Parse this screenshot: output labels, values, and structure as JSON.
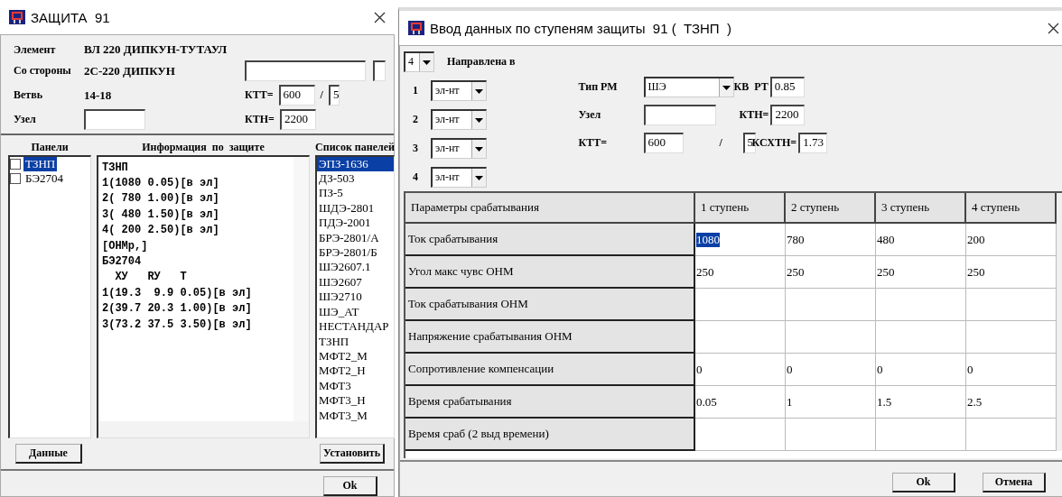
{
  "left_window": {
    "title": "ЗАЩИТА  91",
    "fields": {
      "element_label": "Элемент",
      "element_value": "ВЛ 220 ДИПКУН-ТУТАУЛ",
      "side_label": "Со стороны",
      "side_value": "2С-220 ДИПКУН",
      "branch_label": "Ветвь",
      "branch_value": "14-18",
      "node_label": "Узел",
      "ktt_label": "КТТ=",
      "ktt_value": "600",
      "ktt_sep": "/",
      "ktt_value2": "5",
      "ktn_label": "КТН=",
      "ktn_value": "2200"
    },
    "panels": {
      "header": "Панели",
      "items": [
        {
          "label": "ТЗНП",
          "checked": false,
          "selected": true
        },
        {
          "label": "БЭ2704",
          "checked": false,
          "selected": false
        }
      ]
    },
    "info": {
      "header": "Информация  по  защите",
      "lines": [
        "ТЗНП",
        "1(1080 0.05)[в эл]",
        "2( 780 1.00)[в эл]",
        "3( 480 1.50)[в эл]",
        "4( 200 2.50)[в эл]",
        "[ОНМр,]",
        "БЭ2704",
        "  ХУ   RУ   Т",
        "1(19.3  9.9 0.05)[в эл]",
        "2(39.7 20.3 1.00)[в эл]",
        "3(73.2 37.5 3.50)[в эл]"
      ]
    },
    "panel_list": {
      "header": "Список панелей",
      "items": [
        {
          "label": "ЭПЗ-1636",
          "selected": true
        },
        {
          "label": "ДЗ-503",
          "selected": false
        },
        {
          "label": "ПЗ-5",
          "selected": false
        },
        {
          "label": "ШДЭ-2801",
          "selected": false
        },
        {
          "label": "ПДЭ-2001",
          "selected": false
        },
        {
          "label": "БРЭ-2801/А",
          "selected": false
        },
        {
          "label": "БРЭ-2801/Б",
          "selected": false
        },
        {
          "label": "ШЭ2607.1",
          "selected": false
        },
        {
          "label": "ШЭ2607",
          "selected": false
        },
        {
          "label": "ШЭ2710",
          "selected": false
        },
        {
          "label": "ШЭ_АТ",
          "selected": false
        },
        {
          "label": "НЕСТАНДАР",
          "selected": false
        },
        {
          "label": "ТЗНП",
          "selected": false
        },
        {
          "label": "МФТ2_М",
          "selected": false
        },
        {
          "label": "МФТ2_Н",
          "selected": false
        },
        {
          "label": "МФТ3",
          "selected": false
        },
        {
          "label": "МФТ3_Н",
          "selected": false
        },
        {
          "label": "МФТ3_М",
          "selected": false
        }
      ]
    },
    "buttons": [
      "Данные",
      "Установить",
      "Ok"
    ]
  },
  "right_window": {
    "title": "Ввод данных по ступеням защиты  91 (  ТЗНП  )",
    "steps_count": "4",
    "direction_label": "Направлена в",
    "directions": [
      {
        "number": "1",
        "value": "эл-нт"
      },
      {
        "number": "2",
        "value": "эл-нт"
      },
      {
        "number": "3",
        "value": "эл-нт"
      },
      {
        "number": "4",
        "value": "эл-нт"
      }
    ],
    "params": {
      "type_label": "Тип РМ",
      "type_value": "ШЭ",
      "kv_label": "КВ  РТ",
      "kv_value": "0.85",
      "node_label": "Узел",
      "ktn_label": "КТН=",
      "ktn_value": "2200",
      "ktt_label": "КТТ=",
      "ktt_value": "600",
      "ktt_sep": "/",
      "ktt_value2": "5",
      "ksxtn_label": "КСХТН=",
      "ksxtn_value": "1.73"
    },
    "table": {
      "columns": [
        "Параметры срабатывания",
        "1 ступень",
        "2 ступень",
        "3 ступень",
        "4 ступень"
      ],
      "rows": [
        {
          "label": "Ток срабатывания",
          "cells": [
            {
              "text": "1080",
              "selected": true
            },
            {
              "text": "780",
              "selected": false
            },
            {
              "text": "480",
              "selected": false
            },
            {
              "text": "200",
              "selected": false
            }
          ]
        },
        {
          "label": "Угол макс чувс ОНМ",
          "cells": [
            {
              "text": "250",
              "selected": false
            },
            {
              "text": "250",
              "selected": false
            },
            {
              "text": "250",
              "selected": false
            },
            {
              "text": "250",
              "selected": false
            }
          ]
        },
        {
          "label": "Ток срабатывания ОНМ"
        },
        {
          "label": "Напряжение срабатывания ОНМ"
        },
        {
          "label": "Сопротивление компенсации",
          "cells": [
            {
              "text": "0",
              "selected": false
            },
            {
              "text": "0",
              "selected": false
            },
            {
              "text": "0",
              "selected": false
            },
            {
              "text": "0",
              "selected": false
            }
          ]
        },
        {
          "label": "Время срабатывания",
          "cells": [
            {
              "text": "0.05",
              "selected": false
            },
            {
              "text": "1",
              "selected": false
            },
            {
              "text": "1.5",
              "selected": false
            },
            {
              "text": "2.5",
              "selected": false
            }
          ]
        },
        {
          "label": "Время сраб (2 выд времени)"
        }
      ]
    },
    "buttons": [
      "Ok",
      "Отмена"
    ]
  }
}
